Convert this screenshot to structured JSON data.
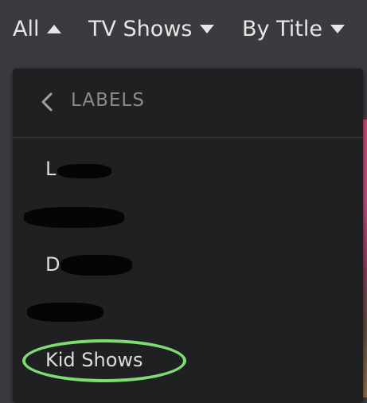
{
  "filters": {
    "all_label": "All",
    "section_label": "TV Shows",
    "sort_label": "By Title"
  },
  "dropdown": {
    "title": "LABELS",
    "items": [
      {
        "label": "L",
        "redacted": true
      },
      {
        "label": "",
        "redacted": true
      },
      {
        "label": "D",
        "redacted": true
      },
      {
        "label": "",
        "redacted": true
      },
      {
        "label": "Kid Shows",
        "redacted": false,
        "highlighted": true
      }
    ]
  },
  "colors": {
    "highlight_ring": "#7fdc72",
    "menu_background": "#1f2022",
    "bar_background": "#3a3b3e"
  }
}
